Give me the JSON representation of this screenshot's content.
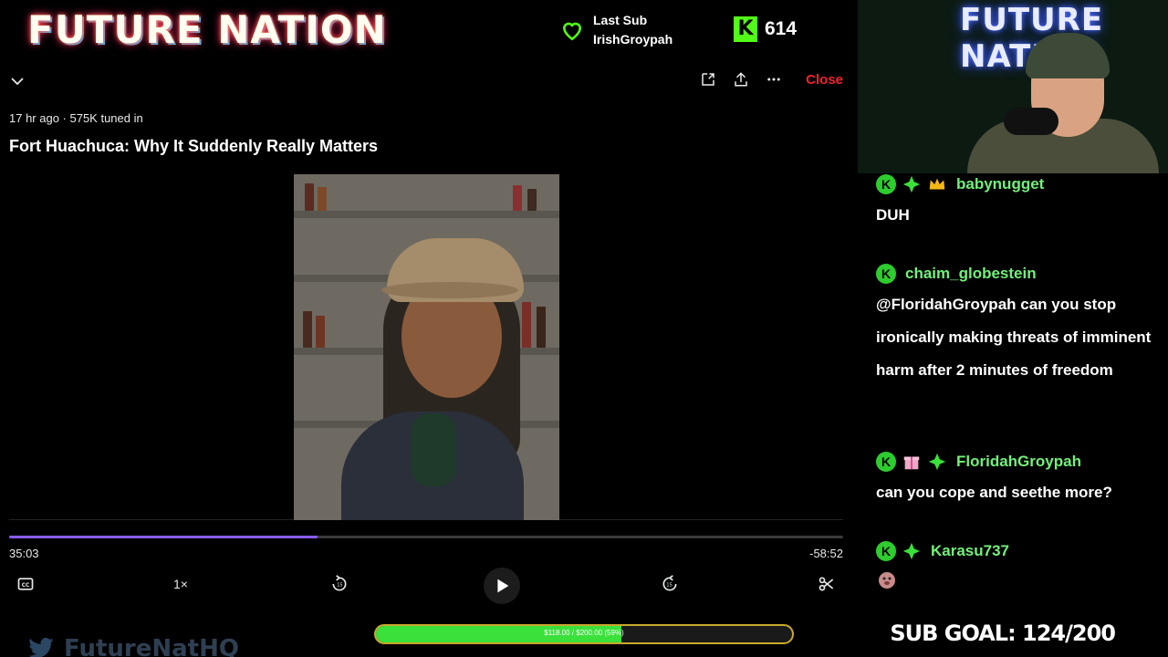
{
  "overlay": {
    "logo": "FUTURE NATION",
    "last_sub_label": "Last Sub",
    "last_sub_name": "IrishGroypah",
    "kick_logo": "K",
    "viewer_count": "614"
  },
  "player": {
    "meta": "17 hr ago · 575K tuned in",
    "title": "Fort Huachuca: Why It Suddenly Really Matters",
    "close_label": "Close",
    "progress": 0.37,
    "time_elapsed": "35:03",
    "time_remaining": "-58:52",
    "speed_label": "1×",
    "icons": [
      "chevron-down-icon",
      "dock-icon",
      "share-icon",
      "more-icon",
      "captions-icon",
      "rewind-15-icon",
      "play-icon",
      "forward-15-icon",
      "clip-icon"
    ]
  },
  "webcam": {
    "neon_text": "FUTURE NATION"
  },
  "chat": {
    "messages": [
      {
        "username": "babynugget",
        "text": "DUH",
        "badges": [
          "kick-icon",
          "sparkle-icon",
          "crown-icon"
        ]
      },
      {
        "username": "chaim_globestein",
        "text": "@FloridahGroypah can you stop ironically making threats of imminent harm after 2 minutes of freedom",
        "badges": [
          "kick-icon"
        ]
      },
      {
        "username": "FloridahGroypah",
        "text": "can you cope and seethe more?",
        "badges": [
          "kick-icon",
          "gift-icon",
          "sparkle-icon"
        ]
      },
      {
        "username": "Karasu737",
        "text": "",
        "badges": [
          "kick-icon",
          "sparkle-icon"
        ]
      }
    ]
  },
  "bottom": {
    "twitter_handle": "FutureNatHQ",
    "goal_text": "$118.00 / $200.00 (59%)",
    "goal_progress": 0.59,
    "sub_goal": "SUB GOAL: 124/200"
  },
  "colors": {
    "kick_green": "#53fc18",
    "close_red": "#f4212e",
    "progress_purple": "#8b5cf6",
    "username_green": "#72f07a"
  }
}
